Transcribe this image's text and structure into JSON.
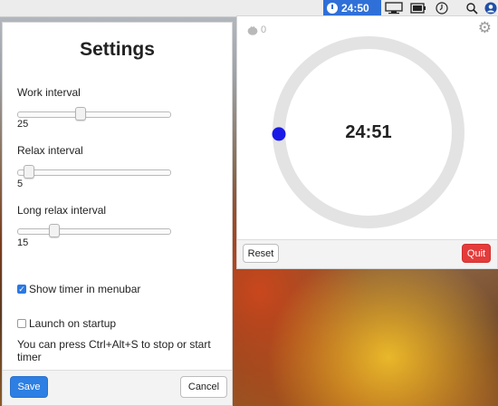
{
  "menubar": {
    "timer_display": "24:50",
    "icons": [
      "timer-clock-icon",
      "display-icon",
      "battery-icon",
      "clock-icon",
      "search-icon",
      "user-icon"
    ]
  },
  "settings": {
    "title": "Settings",
    "work_interval": {
      "label": "Work interval",
      "value": "25",
      "min": 1,
      "max": 60
    },
    "relax_interval": {
      "label": "Relax interval",
      "value": "5",
      "min": 1,
      "max": 60
    },
    "long_relax_interval": {
      "label": "Long relax interval",
      "value": "15",
      "min": 1,
      "max": 60
    },
    "show_in_menubar": {
      "label": "Show timer in menubar",
      "checked": true
    },
    "launch_on_startup": {
      "label": "Launch on startup",
      "checked": false
    },
    "hint": "You can press Ctrl+Alt+S to stop or start timer",
    "save_label": "Save",
    "cancel_label": "Cancel"
  },
  "timer": {
    "session_count": "0",
    "time": "24:51",
    "reset_label": "Reset",
    "quit_label": "Quit",
    "progress_fraction": 0.003,
    "accent_color": "#1a1ae6",
    "ring_color": "#e3e3e3",
    "quit_color": "#e53b3b",
    "save_color": "#2d7fe3"
  }
}
